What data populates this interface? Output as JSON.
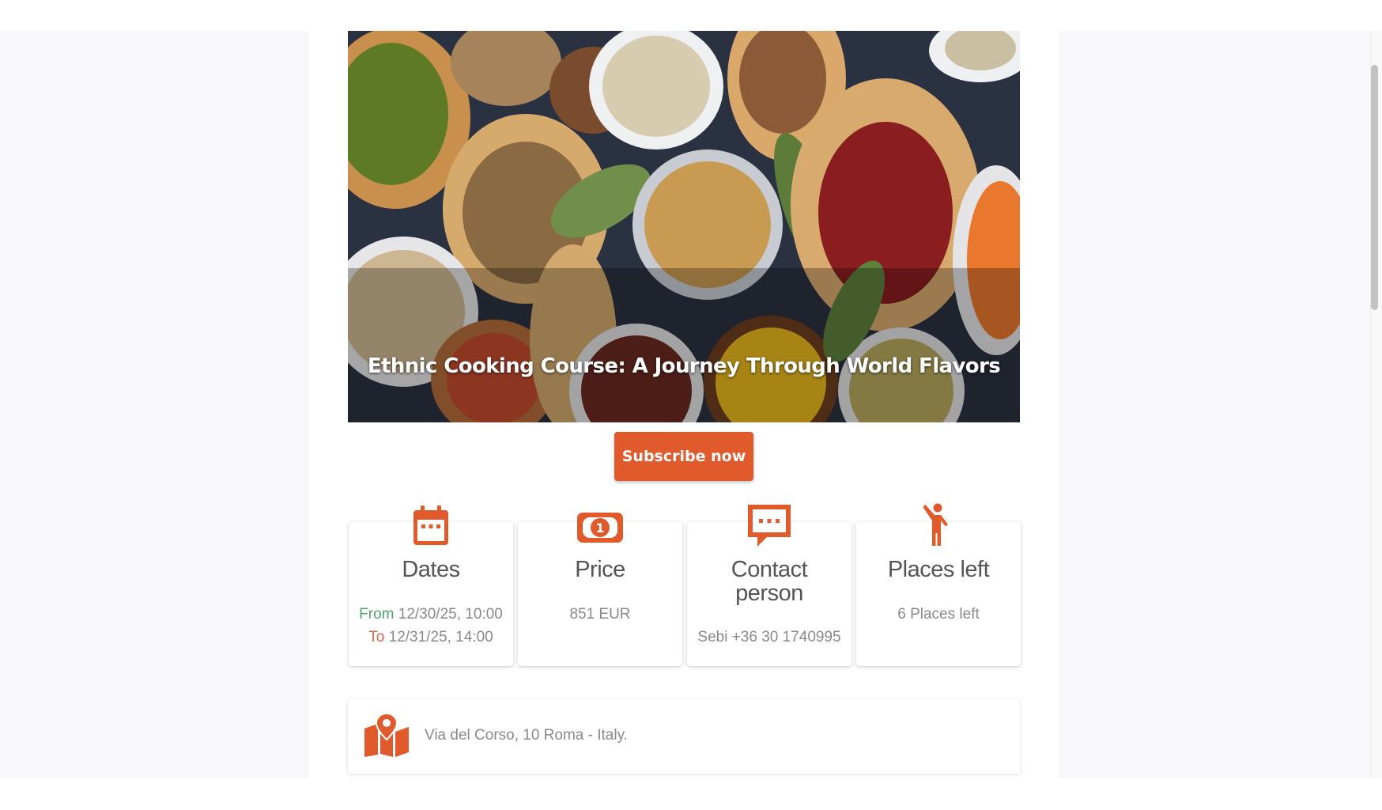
{
  "event": {
    "title": "Ethnic Cooking Course: A Journey Through World Flavors",
    "hero_image": "legumes-and-grains-in-bowls"
  },
  "cta": {
    "subscribe_label": "Subscribe now"
  },
  "cards": {
    "dates": {
      "icon": "calendar-icon",
      "title": "Dates",
      "from_label": "From",
      "from_value": "12/30/25, 10:00",
      "to_label": "To",
      "to_value": "12/31/25, 14:00"
    },
    "price": {
      "icon": "money-icon",
      "title": "Price",
      "value": "851 EUR"
    },
    "contact": {
      "icon": "chat-icon",
      "title_line1": "Contact",
      "title_line2": "person",
      "value": "Sebi +36 30 1740995"
    },
    "places": {
      "icon": "person-icon",
      "title": "Places left",
      "value": "6 Places left"
    }
  },
  "location": {
    "icon": "map-pin-icon",
    "address": "Via del Corso, 10 Roma - Italy."
  },
  "colors": {
    "accent": "#e05a2b",
    "from_label": "#4fa56d",
    "to_label": "#e0654f",
    "text_muted": "#8a8a8a",
    "page_background": "#f8f8fa"
  }
}
